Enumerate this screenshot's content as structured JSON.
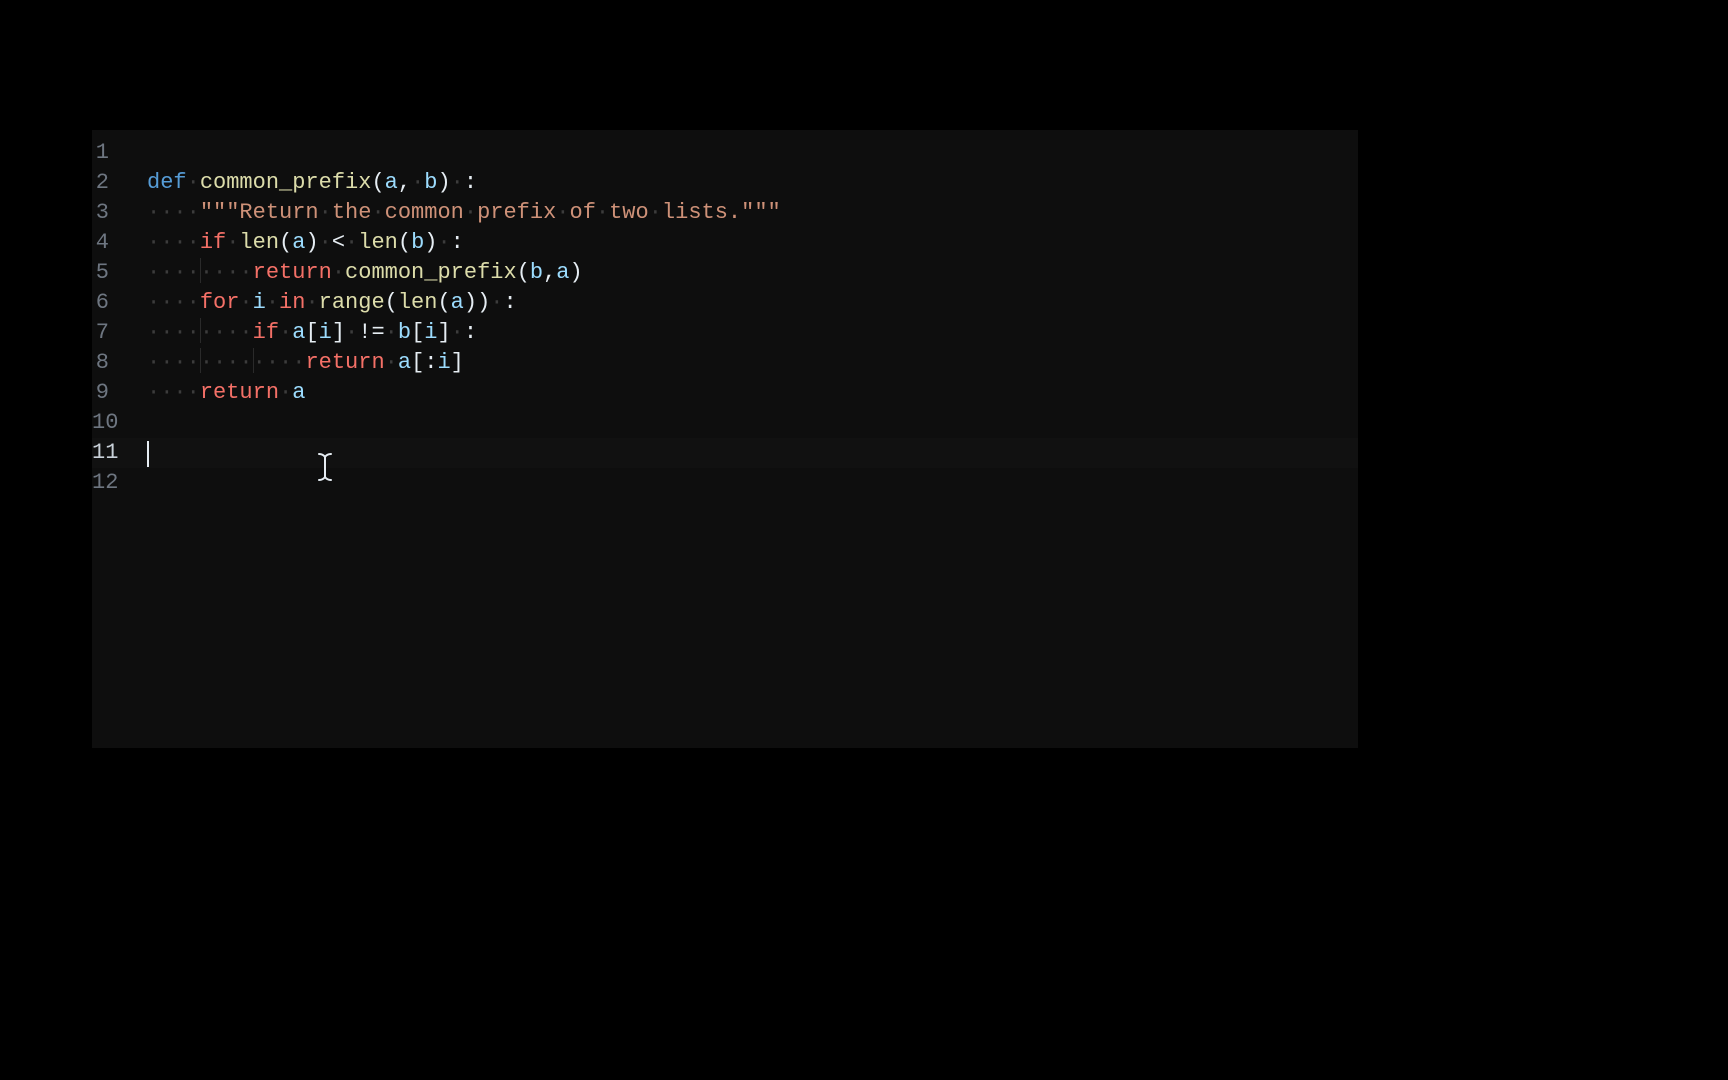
{
  "editor": {
    "cursor_line": 11,
    "lines": [
      {
        "num": 1,
        "tokens": []
      },
      {
        "num": 2,
        "tokens": [
          {
            "t": "def",
            "c": "def "
          },
          {
            "t": "fn",
            "c": "common_prefix"
          },
          {
            "t": "punct",
            "c": "("
          },
          {
            "t": "param",
            "c": "a"
          },
          {
            "t": "punct",
            "c": ","
          },
          {
            "t": "ws",
            "c": " "
          },
          {
            "t": "param",
            "c": "b"
          },
          {
            "t": "punct",
            "c": ")"
          },
          {
            "t": "ws",
            "c": " "
          },
          {
            "t": "punct",
            "c": ":"
          }
        ]
      },
      {
        "num": 3,
        "indent": 1,
        "tokens": [
          {
            "t": "str",
            "c": "\"\"\"Return the common prefix of two lists.\"\"\""
          }
        ]
      },
      {
        "num": 4,
        "indent": 1,
        "tokens": [
          {
            "t": "keyword",
            "c": "if"
          },
          {
            "t": "ws",
            "c": " "
          },
          {
            "t": "builtin",
            "c": "len"
          },
          {
            "t": "punct",
            "c": "("
          },
          {
            "t": "var",
            "c": "a"
          },
          {
            "t": "punct",
            "c": ")"
          },
          {
            "t": "ws",
            "c": " "
          },
          {
            "t": "op",
            "c": "<"
          },
          {
            "t": "ws",
            "c": " "
          },
          {
            "t": "builtin",
            "c": "len"
          },
          {
            "t": "punct",
            "c": "("
          },
          {
            "t": "var",
            "c": "b"
          },
          {
            "t": "punct",
            "c": ")"
          },
          {
            "t": "ws",
            "c": " "
          },
          {
            "t": "punct",
            "c": ":"
          }
        ]
      },
      {
        "num": 5,
        "indent": 2,
        "tokens": [
          {
            "t": "keyword",
            "c": "return"
          },
          {
            "t": "ws",
            "c": " "
          },
          {
            "t": "fn",
            "c": "common_prefix"
          },
          {
            "t": "punct",
            "c": "("
          },
          {
            "t": "var",
            "c": "b"
          },
          {
            "t": "punct",
            "c": ","
          },
          {
            "t": "var",
            "c": "a"
          },
          {
            "t": "punct",
            "c": ")"
          }
        ]
      },
      {
        "num": 6,
        "indent": 1,
        "tokens": [
          {
            "t": "keyword",
            "c": "for"
          },
          {
            "t": "ws",
            "c": " "
          },
          {
            "t": "var",
            "c": "i"
          },
          {
            "t": "ws",
            "c": " "
          },
          {
            "t": "keyword",
            "c": "in"
          },
          {
            "t": "ws",
            "c": " "
          },
          {
            "t": "builtin",
            "c": "range"
          },
          {
            "t": "punct",
            "c": "("
          },
          {
            "t": "builtin",
            "c": "len"
          },
          {
            "t": "punct",
            "c": "("
          },
          {
            "t": "var",
            "c": "a"
          },
          {
            "t": "punct",
            "c": ")"
          },
          {
            "t": "punct",
            "c": ")"
          },
          {
            "t": "ws",
            "c": " "
          },
          {
            "t": "punct",
            "c": ":"
          }
        ]
      },
      {
        "num": 7,
        "indent": 2,
        "tokens": [
          {
            "t": "keyword",
            "c": "if"
          },
          {
            "t": "ws",
            "c": " "
          },
          {
            "t": "var",
            "c": "a"
          },
          {
            "t": "punct",
            "c": "["
          },
          {
            "t": "var",
            "c": "i"
          },
          {
            "t": "punct",
            "c": "]"
          },
          {
            "t": "ws",
            "c": " "
          },
          {
            "t": "op",
            "c": "!="
          },
          {
            "t": "ws",
            "c": " "
          },
          {
            "t": "var",
            "c": "b"
          },
          {
            "t": "punct",
            "c": "["
          },
          {
            "t": "var",
            "c": "i"
          },
          {
            "t": "punct",
            "c": "]"
          },
          {
            "t": "ws",
            "c": " "
          },
          {
            "t": "punct",
            "c": ":"
          }
        ]
      },
      {
        "num": 8,
        "indent": 3,
        "tokens": [
          {
            "t": "keyword",
            "c": "return"
          },
          {
            "t": "ws",
            "c": " "
          },
          {
            "t": "var",
            "c": "a"
          },
          {
            "t": "punct",
            "c": "[:"
          },
          {
            "t": "var",
            "c": "i"
          },
          {
            "t": "punct",
            "c": "]"
          }
        ]
      },
      {
        "num": 9,
        "indent": 1,
        "tokens": [
          {
            "t": "keyword",
            "c": "return"
          },
          {
            "t": "ws",
            "c": " "
          },
          {
            "t": "var",
            "c": "a"
          }
        ]
      },
      {
        "num": 10,
        "tokens": []
      },
      {
        "num": 11,
        "tokens": [],
        "cursor": true
      },
      {
        "num": 12,
        "tokens": []
      }
    ]
  }
}
